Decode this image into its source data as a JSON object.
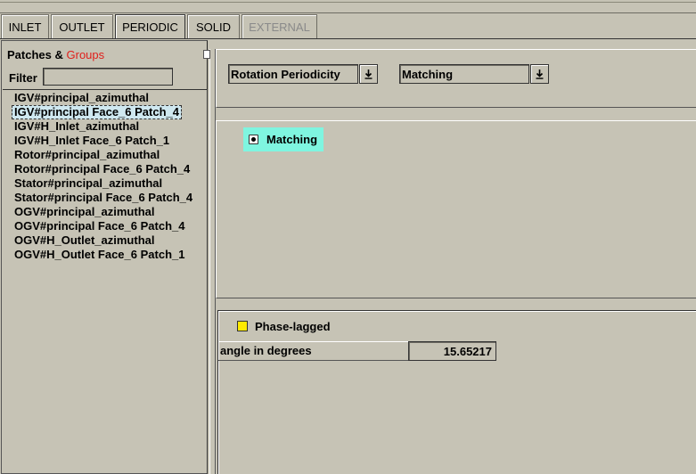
{
  "tabs": [
    {
      "label": "INLET",
      "state": "normal"
    },
    {
      "label": "OUTLET",
      "state": "normal"
    },
    {
      "label": "PERIODIC",
      "state": "active"
    },
    {
      "label": "SOLID",
      "state": "normal"
    },
    {
      "label": "EXTERNAL",
      "state": "disabled"
    }
  ],
  "left_panel": {
    "title_patches": "Patches &",
    "title_groups": "Groups",
    "filter_label": "Filter",
    "filter_value": "",
    "items": [
      "IGV#principal_azimuthal",
      "IGV#principal Face_6 Patch_4",
      "IGV#H_Inlet_azimuthal",
      "IGV#H_Inlet Face_6 Patch_1",
      "Rotor#principal_azimuthal",
      "Rotor#principal Face_6 Patch_4",
      "Stator#principal_azimuthal",
      "Stator#principal Face_6 Patch_4",
      "OGV#principal_azimuthal",
      "OGV#principal Face_6 Patch_4",
      "OGV#H_Outlet_azimuthal",
      "OGV#H_Outlet Face_6 Patch_1"
    ],
    "selected_index": 1
  },
  "periodicity": {
    "type_combo": "Rotation Periodicity",
    "mode_combo": "Matching",
    "radio_label": "Matching",
    "phase_lagged_label": "Phase-lagged",
    "angle_label": "angle in degrees",
    "angle_value": "15.65217"
  },
  "colors": {
    "background": "#c6c3b5",
    "groups_text": "#e0201c",
    "radio_highlight": "#7ff5e0",
    "checkbox_fill": "#ffea00",
    "selection": "#cfe8f0"
  }
}
